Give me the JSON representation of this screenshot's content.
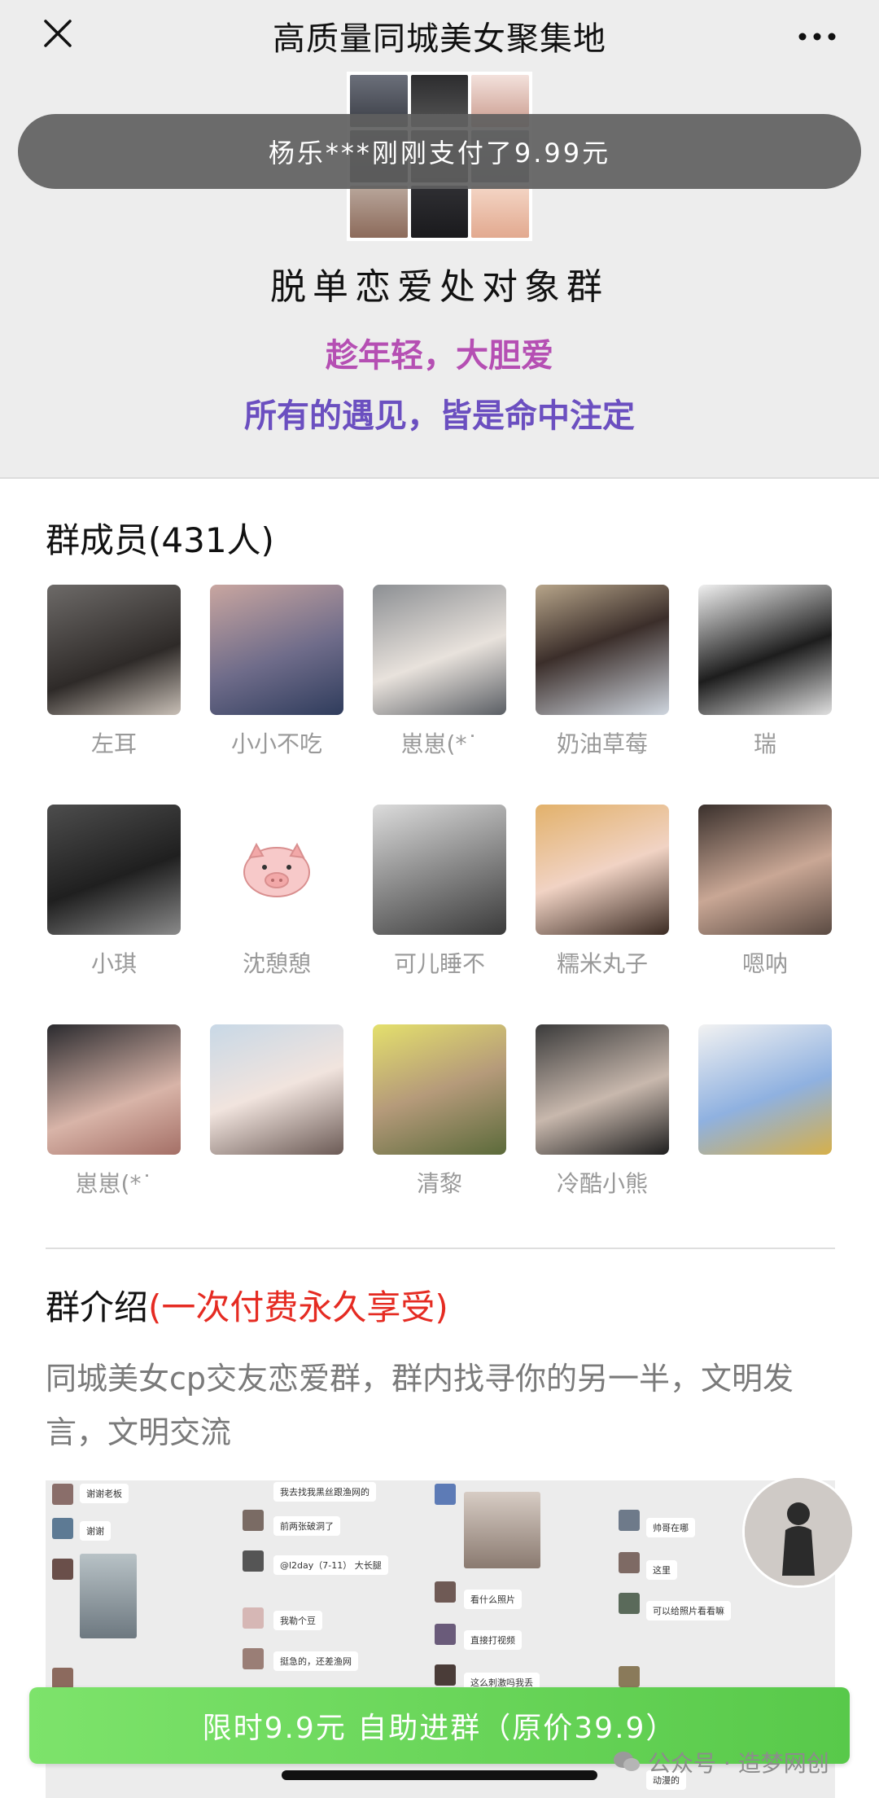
{
  "nav": {
    "title": "高质量同城美女聚集地",
    "close_icon": "close-icon",
    "more_icon": "more-icon"
  },
  "toast": {
    "text": "杨乐***刚刚支付了9.99元"
  },
  "header": {
    "group_name": "脱单恋爱处对象群",
    "slogan1": "趁年轻，大胆爱",
    "slogan2": "所有的遇见，皆是命中注定",
    "slogan1_color": "#b54fb3",
    "slogan2_color": "#6b4fc0"
  },
  "members": {
    "title": "群成员(431人)",
    "items": [
      {
        "name": "左耳"
      },
      {
        "name": "小小不吃"
      },
      {
        "name": "崽崽(*˙"
      },
      {
        "name": "奶油草莓"
      },
      {
        "name": "瑞"
      },
      {
        "name": "小琪"
      },
      {
        "name": "沈憩憩"
      },
      {
        "name": "可儿睡不"
      },
      {
        "name": "糯米丸子"
      },
      {
        "name": "嗯呐"
      },
      {
        "name": "崽崽(*˙"
      },
      {
        "name": ""
      },
      {
        "name": "清黎"
      },
      {
        "name": "冷酷小熊"
      },
      {
        "name": ""
      }
    ]
  },
  "intro": {
    "title": "群介绍",
    "title_note": "(一次付费永久享受)",
    "text": "同城美女cp交友恋爱群，群内找寻你的另一半，文明发言，文明交流"
  },
  "chat": {
    "col1": [
      "谢谢老板",
      "谢谢"
    ],
    "col2": [
      "我去找我黑丝跟渔网的",
      "前两张破洞了",
      "@l2day（7-11） 大长腿",
      "我勒个豆",
      "挺急的，还差渔网"
    ],
    "col3": [
      "看什么照片",
      "直接打视频",
      "这么刺激吗我丢"
    ],
    "col4": [
      "帅哥在哪",
      "这里",
      "可以给照片看看嘛",
      "动漫的"
    ]
  },
  "cta": {
    "label": "限时9.9元 自助进群（原价39.9）"
  },
  "watermark": {
    "text": "公众号 · 造梦网创"
  },
  "colors": {
    "cta": "#6bd75a",
    "toast": "#5f5f5f",
    "red_note": "#e52b22"
  }
}
